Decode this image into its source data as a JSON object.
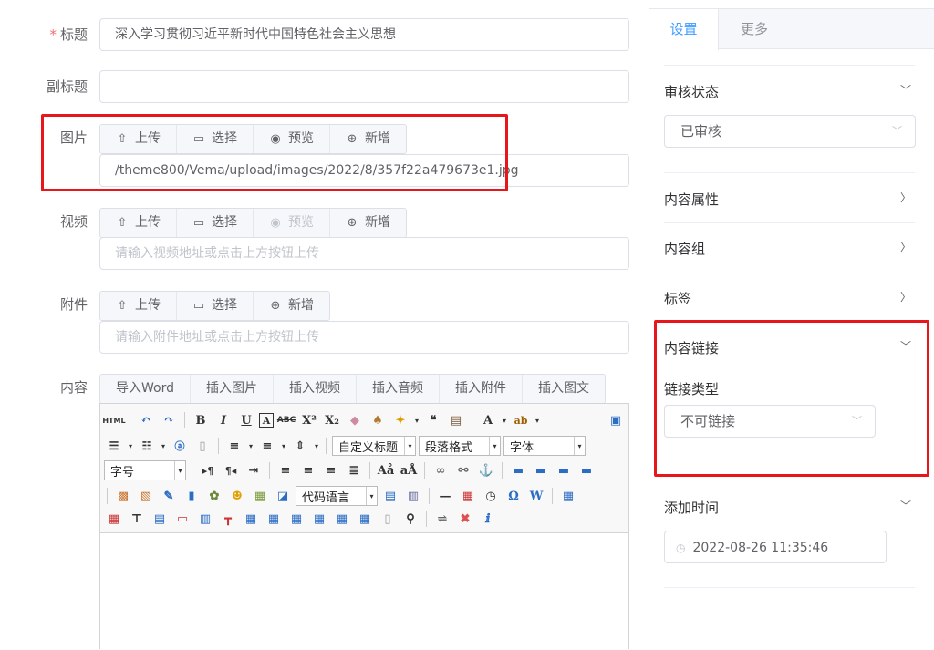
{
  "form": {
    "title": {
      "required_mark": "*",
      "label": "标题",
      "value": "深入学习贯彻习近平新时代中国特色社会主义思想"
    },
    "subtitle": {
      "label": "副标题",
      "value": ""
    },
    "image": {
      "label": "图片",
      "buttons": [
        {
          "icon": "upload-icon",
          "glyph": "⇧",
          "label": "上传"
        },
        {
          "icon": "folder-icon",
          "glyph": "▭",
          "label": "选择"
        },
        {
          "icon": "eye-icon",
          "glyph": "◉",
          "label": "预览"
        },
        {
          "icon": "plus-circle-icon",
          "glyph": "⊕",
          "label": "新增"
        }
      ],
      "value": "/theme800/Vema/upload/images/2022/8/357f22a479673e1.jpg"
    },
    "video": {
      "label": "视频",
      "buttons": [
        {
          "icon": "upload-icon",
          "glyph": "⇧",
          "label": "上传"
        },
        {
          "icon": "folder-icon",
          "glyph": "▭",
          "label": "选择"
        },
        {
          "icon": "eye-icon",
          "glyph": "◉",
          "label": "预览"
        },
        {
          "icon": "plus-circle-icon",
          "glyph": "⊕",
          "label": "新增"
        }
      ],
      "placeholder": "请输入视频地址或点击上方按钮上传"
    },
    "attachment": {
      "label": "附件",
      "buttons": [
        {
          "icon": "upload-icon",
          "glyph": "⇧",
          "label": "上传"
        },
        {
          "icon": "folder-icon",
          "glyph": "▭",
          "label": "选择"
        },
        {
          "icon": "plus-circle-icon",
          "glyph": "⊕",
          "label": "新增"
        }
      ],
      "placeholder": "请输入附件地址或点击上方按钮上传"
    },
    "content": {
      "label": "内容",
      "buttons": [
        "导入Word",
        "插入图片",
        "插入视频",
        "插入音频",
        "插入附件",
        "插入图文"
      ]
    }
  },
  "editor": {
    "html_label": "HTML",
    "combos": {
      "custom_heading": "自定义标题",
      "paragraph_format": "段落格式",
      "font_family": "字体",
      "font_size": "字号",
      "code_language": "代码语言"
    }
  },
  "panel": {
    "tabs": [
      "设置",
      "更多"
    ],
    "review_status": {
      "label": "审核状态",
      "value": "已审核"
    },
    "content_attributes": "内容属性",
    "content_group": "内容组",
    "tags": "标签",
    "content_link": {
      "label": "内容链接",
      "link_type_label": "链接类型",
      "link_type_value": "不可链接"
    },
    "add_time": {
      "label": "添加时间",
      "value": "2022-08-26 11:35:46"
    }
  },
  "colors": {
    "accent": "#409eff",
    "highlight_border": "#e8161b",
    "required": "#f56c6c"
  }
}
